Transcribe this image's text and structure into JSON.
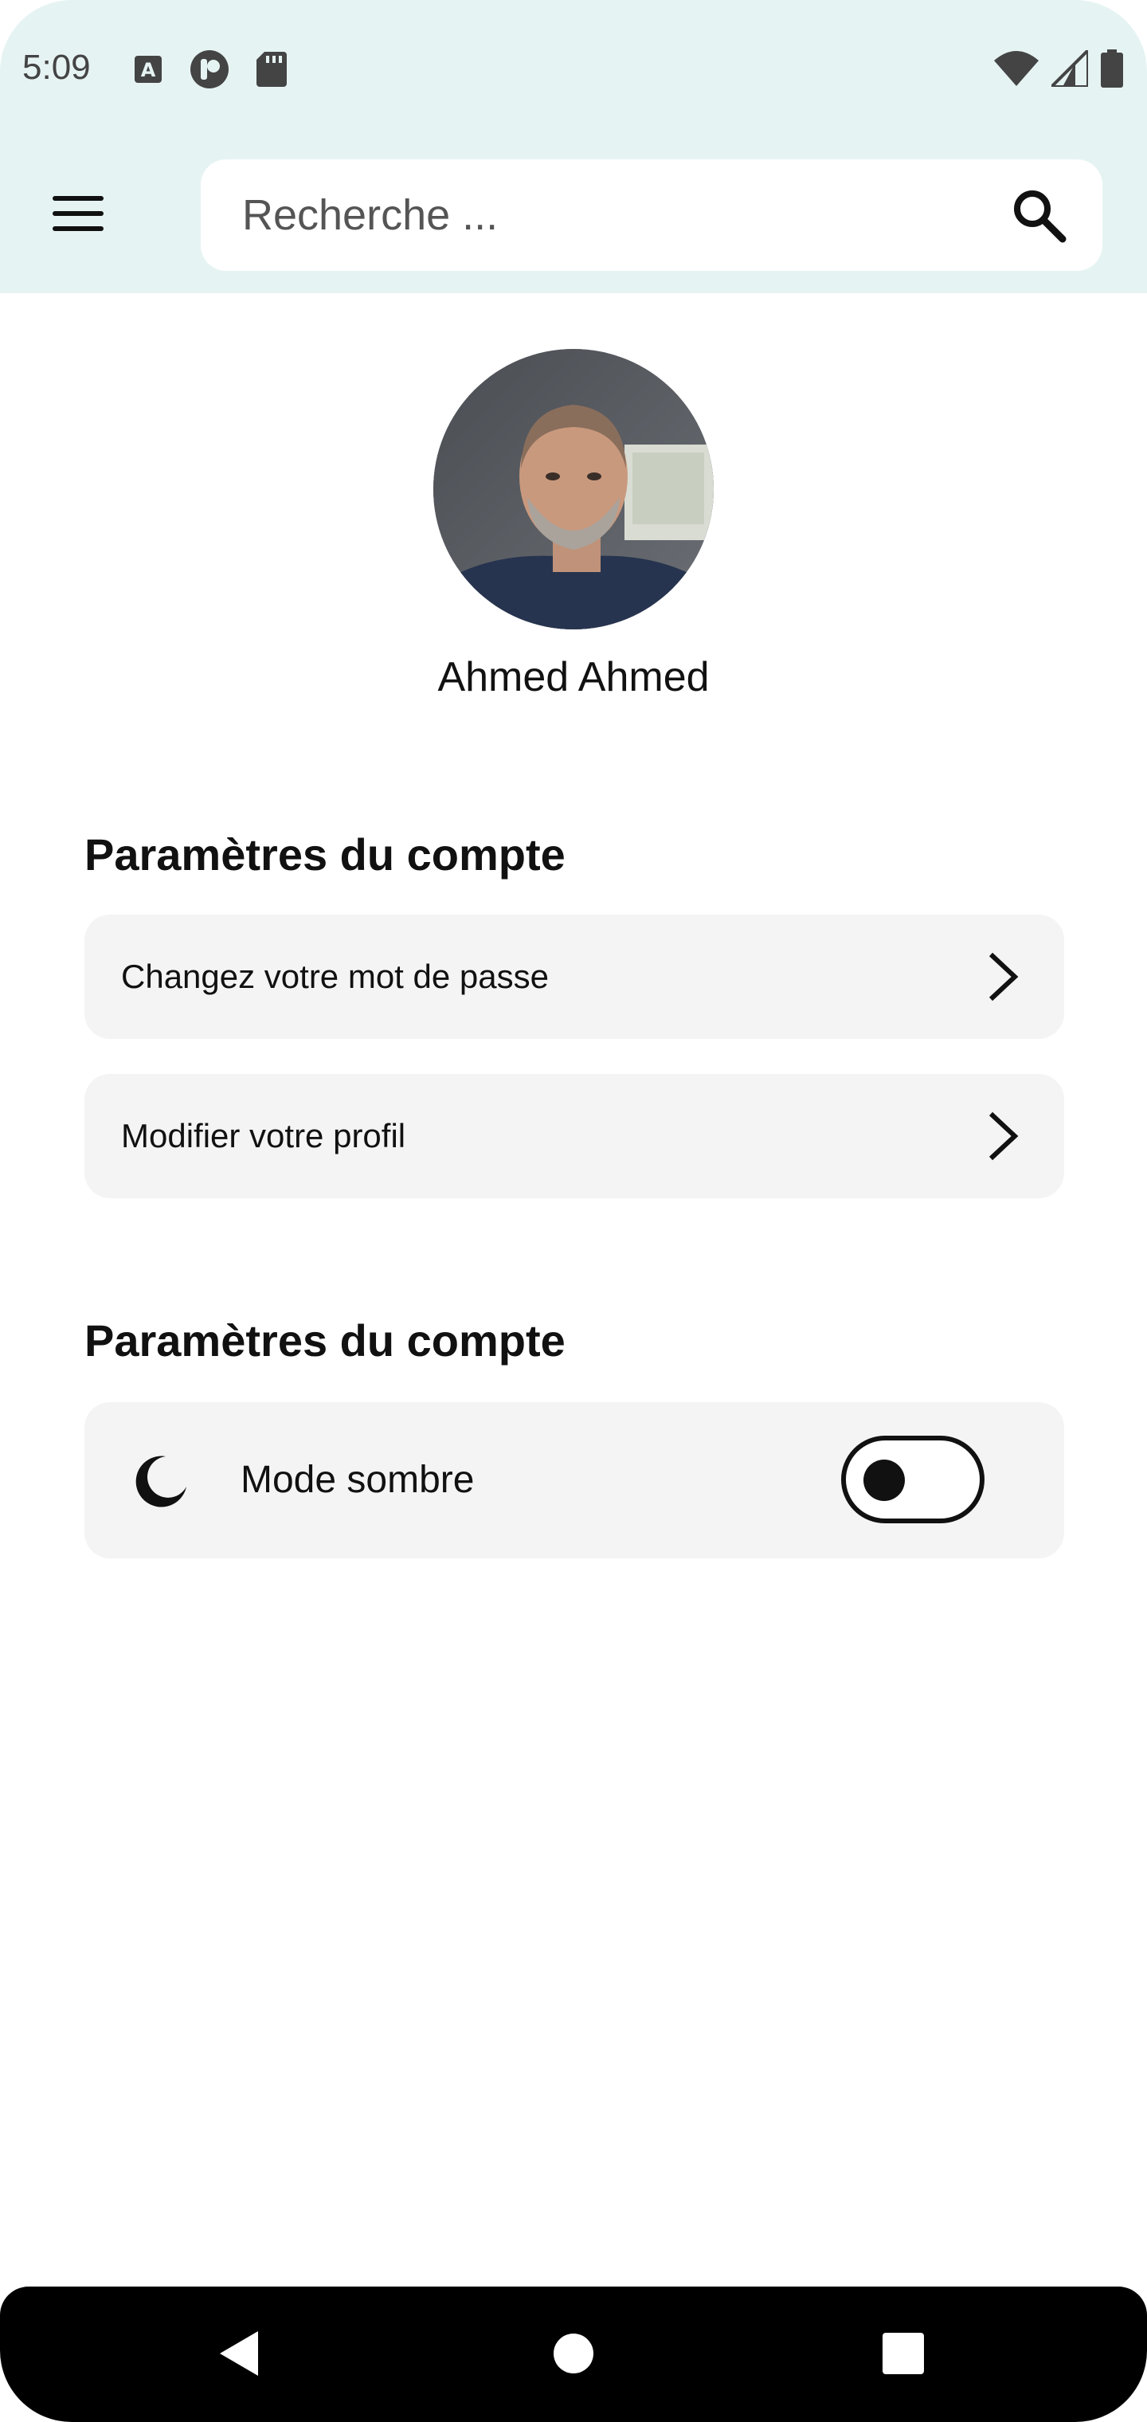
{
  "status_bar": {
    "time": "5:09",
    "left_icons": [
      "keyboard-a-icon",
      "app-badge-icon",
      "sd-card-icon"
    ],
    "right_icons": [
      "wifi-icon",
      "signal-icon",
      "battery-icon"
    ]
  },
  "app_bar": {
    "menu_icon": "hamburger-menu-icon",
    "search": {
      "placeholder": "Recherche ...",
      "value": "",
      "icon": "search-icon"
    }
  },
  "profile": {
    "name": "Ahmed Ahmed"
  },
  "sections": [
    {
      "title": "Paramètres du compte",
      "items": [
        {
          "label": "Changez votre mot de passe",
          "icon": "chevron-right-icon"
        },
        {
          "label": "Modifier votre profil",
          "icon": "chevron-right-icon"
        }
      ]
    },
    {
      "title": "Paramètres du compte",
      "items": [
        {
          "label": "Mode sombre",
          "icon": "moon-icon",
          "toggle": false
        }
      ]
    }
  ],
  "nav_bar": {
    "buttons": [
      "back-icon",
      "home-icon",
      "recents-icon"
    ]
  },
  "colors": {
    "app_bar_bg": "#e6f3f3",
    "row_bg": "#f4f4f4",
    "text": "#111111",
    "nav_bg": "#000000"
  }
}
